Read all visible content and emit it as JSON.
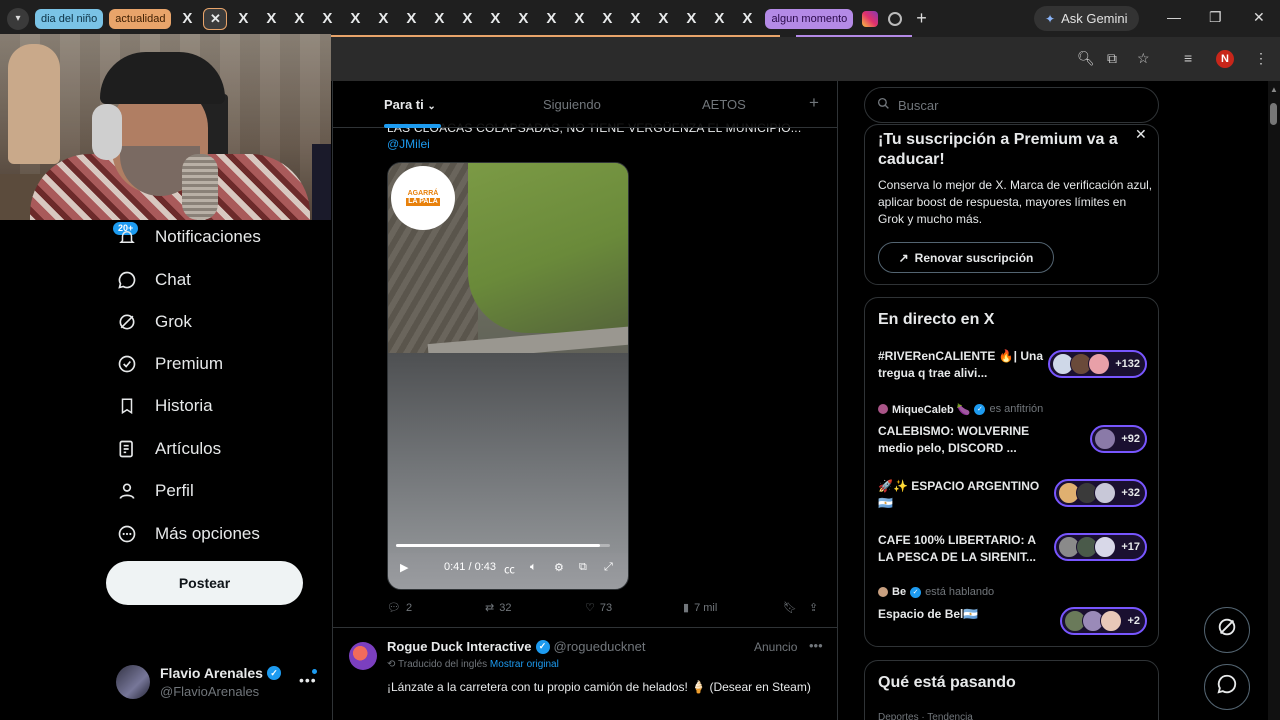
{
  "browser": {
    "tabs": [
      {
        "label": "dia del niño",
        "color": "#7ac3e6"
      },
      {
        "label": "actualidad",
        "color": "#e8a46a"
      },
      {
        "label": "algun momento",
        "color": "#b48ae6"
      }
    ],
    "x_tab_glyph": "X",
    "active_tab_close": "✕",
    "ask_gemini": "Ask Gemini",
    "profile_initial": "N",
    "window_controls": [
      "—",
      "❐",
      "✕"
    ]
  },
  "nav": {
    "badge": "20+",
    "items": [
      {
        "label": "Notificaciones",
        "icon": "bell-icon"
      },
      {
        "label": "Chat",
        "icon": "chat-icon"
      },
      {
        "label": "Grok",
        "icon": "grok-icon"
      },
      {
        "label": "Premium",
        "icon": "premium-icon"
      },
      {
        "label": "Historia",
        "icon": "bookmark-icon"
      },
      {
        "label": "Artículos",
        "icon": "articles-icon"
      },
      {
        "label": "Perfil",
        "icon": "profile-icon"
      },
      {
        "label": "Más opciones",
        "icon": "more-icon"
      }
    ],
    "post_button": "Postear",
    "account": {
      "name": "Flavio Arenales",
      "handle": "@FlavioArenales",
      "more": "•••"
    }
  },
  "timeline": {
    "tabs": [
      "Para ti",
      "Siguiendo",
      "AETOS"
    ],
    "tweet": {
      "cut_text": "LAS CLOACAS COLAPSADAS, NO TIENE VERGÜENZA EL MUNICIPIO...",
      "mention": "@JMilei",
      "video": {
        "logo_line1": "AGARRÁ",
        "logo_line2": "LA PALA",
        "time": "0:41 / 0:43",
        "progress": 0.953
      },
      "stats": {
        "replies": "2",
        "reposts": "32",
        "likes": "73",
        "views": "7 mil"
      }
    },
    "ad": {
      "name": "Rogue Duck Interactive",
      "handle": "@rogueducknet",
      "label": "Anuncio",
      "translated": "Traducido del inglés",
      "show_original": "Mostrar original",
      "text": "¡Lánzate a la carretera con tu propio camión de helados! 🍦 (Desear en Steam)"
    }
  },
  "sidebar": {
    "search_placeholder": "Buscar",
    "premium": {
      "title": "¡Tu suscripción a Premium va a caducar!",
      "body": "Conserva lo mejor de X. Marca de verificación azul, aplicar boost de respuesta, mayores límites en Grok y mucho más.",
      "button": "Renovar suscripción"
    },
    "live": {
      "title": "En directo en X",
      "items": [
        {
          "host": "",
          "host_role": "",
          "text": "#RIVERenCALIENTE 🔥| Una tregua q trae alivi...",
          "count": "+132",
          "avatars": [
            "#cfd8e8",
            "#6a4a3a",
            "#e8a0a8"
          ]
        },
        {
          "host": "MiqueCaleb 🍆",
          "host_role": "es anfitrión",
          "text": "CALEBISMO: WOLVERINE medio pelo, DISCORD ...",
          "count": "+92",
          "avatars": [
            "#8a7aa8"
          ]
        },
        {
          "host": "",
          "host_role": "",
          "text": "🚀✨ ESPACIO ARGENTINO 🇦🇷",
          "count": "+32",
          "avatars": [
            "#e0b070",
            "#3a3a3a",
            "#c8c8d8"
          ]
        },
        {
          "host": "",
          "host_role": "",
          "text": "CAFE 100% LIBERTARIO: A LA PESCA DE LA SIRENIT...",
          "count": "+17",
          "avatars": [
            "#8a8a8a",
            "#4a5a4a",
            "#d8d8e8"
          ]
        },
        {
          "host": "Be",
          "host_role": "está hablando",
          "text": "Espacio de Bel🇦🇷",
          "count": "+2",
          "avatars": [
            "#6a7a5a",
            "#9a8ab8",
            "#e8c8b8"
          ]
        }
      ]
    },
    "trends": {
      "title": "Qué está pasando",
      "sub": "Deportes · Tendencia"
    }
  }
}
